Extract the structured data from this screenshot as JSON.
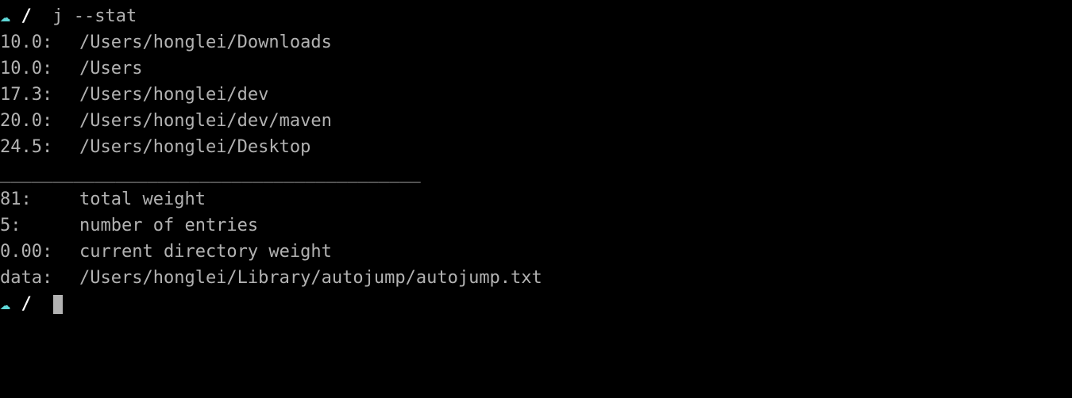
{
  "prompt": {
    "icon": "☁",
    "cwd": "/",
    "command": "j --stat"
  },
  "entries": [
    {
      "weight": "10.0:",
      "path": "/Users/honglei/Downloads"
    },
    {
      "weight": "10.0:",
      "path": "/Users"
    },
    {
      "weight": "17.3:",
      "path": "/Users/honglei/dev"
    },
    {
      "weight": "20.0:",
      "path": "/Users/honglei/dev/maven"
    },
    {
      "weight": "24.5:",
      "path": "/Users/honglei/Desktop"
    }
  ],
  "separator": "________________________________________",
  "blank": "",
  "summary": [
    {
      "key": "81:",
      "label": "total weight"
    },
    {
      "key": "5:",
      "label": "number of entries"
    },
    {
      "key": "0.00:",
      "label": "current directory weight"
    }
  ],
  "data_line": {
    "key": "data:",
    "path": "/Users/honglei/Library/autojump/autojump.txt"
  },
  "prompt2": {
    "icon": "☁",
    "cwd": "/"
  }
}
